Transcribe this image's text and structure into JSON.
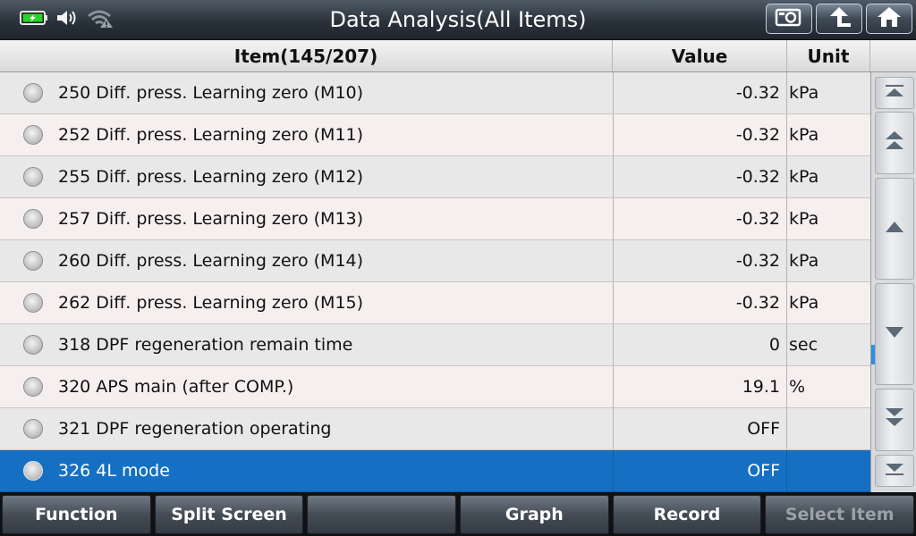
{
  "header": {
    "title": "Data Analysis(All Items)",
    "status_icons": [
      "battery-icon",
      "speaker-icon",
      "wifi-warning-icon"
    ],
    "buttons": [
      "screenshot-icon",
      "back-icon",
      "home-icon"
    ]
  },
  "table": {
    "columns": {
      "item": "Item(145/207)",
      "value": "Value",
      "unit": "Unit"
    },
    "rows": [
      {
        "name": "250 Diff. press. Learning zero (M10)",
        "value": "-0.32",
        "unit": "kPa"
      },
      {
        "name": "252 Diff. press. Learning zero (M11)",
        "value": "-0.32",
        "unit": "kPa"
      },
      {
        "name": "255 Diff. press. Learning zero (M12)",
        "value": "-0.32",
        "unit": "kPa"
      },
      {
        "name": "257 Diff. press. Learning zero (M13)",
        "value": "-0.32",
        "unit": "kPa"
      },
      {
        "name": "260 Diff. press. Learning zero (M14)",
        "value": "-0.32",
        "unit": "kPa"
      },
      {
        "name": "262 Diff. press. Learning zero (M15)",
        "value": "-0.32",
        "unit": "kPa"
      },
      {
        "name": "318 DPF regeneration remain time",
        "value": "0",
        "unit": "sec"
      },
      {
        "name": "320 APS main (after COMP.)",
        "value": "19.1",
        "unit": "%"
      },
      {
        "name": "321 DPF regeneration operating",
        "value": "OFF",
        "unit": ""
      },
      {
        "name": "326 4L mode",
        "value": "OFF",
        "unit": ""
      }
    ],
    "selected_index": 9
  },
  "scrollbar": {
    "buttons": [
      "scroll-to-top-icon",
      "page-up-icon",
      "line-up-icon",
      "line-down-icon",
      "page-down-icon",
      "scroll-to-bottom-icon"
    ]
  },
  "toolbar": {
    "function": "Function",
    "split_screen": "Split Screen",
    "empty": "",
    "graph": "Graph",
    "record": "Record",
    "select_item": "Select Item"
  },
  "colors": {
    "selected_row": "#1570c4",
    "scroll_thumb": "#2d8fe6",
    "battery": "#2bd12b"
  }
}
